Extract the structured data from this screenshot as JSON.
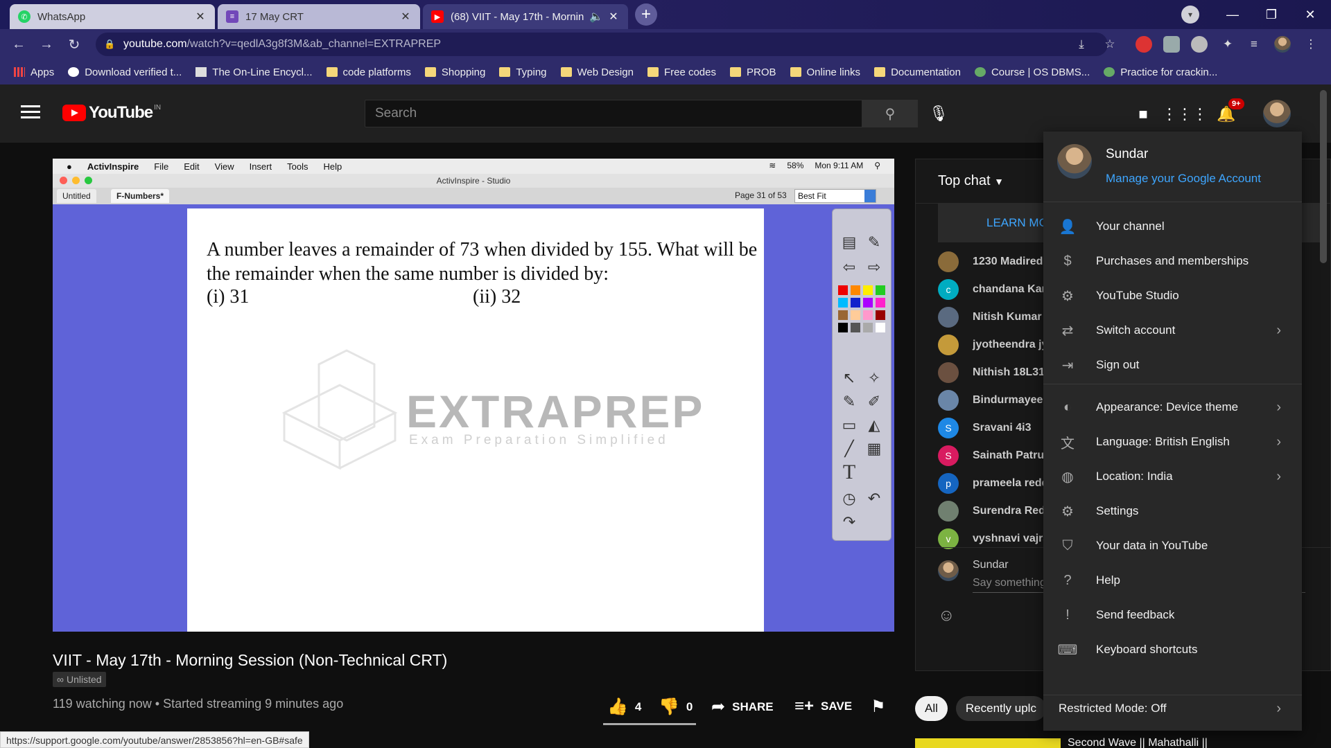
{
  "browser": {
    "tabs": [
      {
        "title": "WhatsApp",
        "favicon_color": "#25d366"
      },
      {
        "title": "17 May CRT",
        "favicon_color": "#7248b9"
      },
      {
        "title": "(68) VIIT - May 17th - Mornin",
        "favicon_color": "#ff0000"
      }
    ],
    "url_host": "youtube.com",
    "url_path": "/watch?v=qedlA3g8f3M&ab_channel=EXTRAPREP",
    "bookmarks": [
      "Apps",
      "Download verified t...",
      "The On-Line Encycl...",
      "code platforms",
      "Shopping",
      "Typing",
      "Web Design",
      "Free codes",
      "PROB",
      "Online links",
      "Documentation",
      "Course | OS DBMS...",
      "Practice for crackin..."
    ],
    "status_url": "https://support.google.com/youtube/answer/2853856?hl=en-GB#safe"
  },
  "yt": {
    "logo_word": "YouTube",
    "country": "IN",
    "search_placeholder": "Search",
    "notif_count": "9+"
  },
  "slide": {
    "mac_menu": [
      "ActivInspire",
      "File",
      "Edit",
      "View",
      "Insert",
      "Tools",
      "Help"
    ],
    "mac_status": [
      "58%",
      "Mon 9:11 AM"
    ],
    "app_title": "ActivInspire - Studio",
    "doc_tabs": [
      "Untitled",
      "F-Numbers*"
    ],
    "page_info": "Page 31 of 53",
    "fit": "Best Fit",
    "question": "A number leaves a remainder of 73 when divided by 155. What will be the remainder when the same number is divided by:",
    "option1": "(i) 31",
    "option2": "(ii) 32",
    "watermark": "EXTRAPREP",
    "watermark_sub": "Exam Preparation Simplified"
  },
  "video": {
    "title": "VIIT - May 17th - Morning Session (Non-Technical CRT)",
    "visibility": "Unlisted",
    "meta": "119 watching now • Started streaming 9 minutes ago",
    "likes": "4",
    "dislikes": "0",
    "share": "SHARE",
    "save": "SAVE"
  },
  "chat": {
    "header": "Top chat",
    "learn_more": "LEARN MC",
    "messages": [
      {
        "name": "1230 Madired",
        "avatar_color": "#8a6b3a",
        "initial": ""
      },
      {
        "name": "chandana Kan",
        "avatar_color": "#00acc1",
        "initial": "c"
      },
      {
        "name": "Nitish Kumar",
        "avatar_color": "#5a6a80",
        "initial": ""
      },
      {
        "name": "jyotheendra jy",
        "avatar_color": "#c49a3a",
        "initial": ""
      },
      {
        "name": "Nithish  18L31",
        "avatar_color": "#6b5040",
        "initial": ""
      },
      {
        "name": "Bindurmayee I",
        "avatar_color": "#6a86a8",
        "initial": ""
      },
      {
        "name": "Sravani 4i3",
        "avatar_color": "#1e88e5",
        "initial": "S"
      },
      {
        "name": "Sainath Patruc",
        "avatar_color": "#d81b60",
        "initial": "S"
      },
      {
        "name": "prameela redd",
        "avatar_color": "#1565c0",
        "initial": "p"
      },
      {
        "name": "Surendra Redc",
        "avatar_color": "#708070",
        "initial": ""
      },
      {
        "name": "vyshnavi vajra",
        "avatar_color": "#7cb342",
        "initial": "v"
      }
    ],
    "user_name": "Sundar",
    "input_placeholder": "Say something",
    "chips": [
      "All",
      "Recently uplc"
    ],
    "rec_title": "Second Wave || Mahathalli ||"
  },
  "menu": {
    "name": "Sundar",
    "manage": "Manage your Google Account",
    "items": [
      {
        "label": "Your channel",
        "icon": "person-icon"
      },
      {
        "label": "Purchases and memberships",
        "icon": "dollar-icon"
      },
      {
        "label": "YouTube Studio",
        "icon": "gear-icon"
      },
      {
        "label": "Switch account",
        "icon": "switch-account-icon"
      },
      {
        "label": "Sign out",
        "icon": "sign-out-icon"
      },
      {
        "label": "Appearance: Device theme",
        "icon": "theme-icon"
      },
      {
        "label": "Language: British English",
        "icon": "translate-icon"
      },
      {
        "label": "Location: India",
        "icon": "globe-icon"
      },
      {
        "label": "Settings",
        "icon": "settings-icon"
      },
      {
        "label": "Your data in YouTube",
        "icon": "shield-icon"
      },
      {
        "label": "Help",
        "icon": "help-icon"
      },
      {
        "label": "Send feedback",
        "icon": "feedback-icon"
      },
      {
        "label": "Keyboard shortcuts",
        "icon": "keyboard-icon"
      }
    ],
    "restricted": "Restricted Mode: Off"
  },
  "colors": {
    "yt_red": "#ff0000",
    "link_blue": "#3ea6ff",
    "slide_bg": "#5f63d8"
  }
}
